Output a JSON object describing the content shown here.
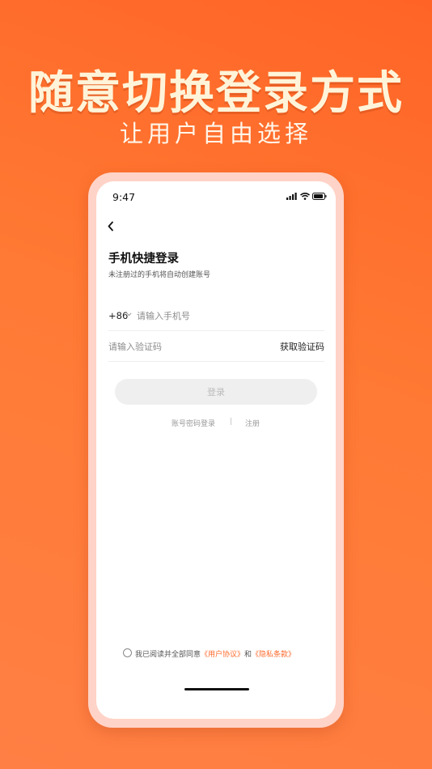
{
  "promo": {
    "headline": "随意切换登录方式",
    "subline": "让用户自由选择"
  },
  "status_bar": {
    "time": "9:47",
    "icons": [
      "signal-icon",
      "wifi-icon",
      "battery-icon"
    ]
  },
  "login": {
    "back_icon": "chevron-left-icon",
    "title": "手机快捷登录",
    "subtitle": "未注册过的手机将自动创建账号",
    "country_code": "+86",
    "phone_placeholder": "请输入手机号",
    "code_placeholder": "请输入验证码",
    "get_code_label": "获取验证码",
    "login_button_label": "登录",
    "password_login_label": "账号密码登录",
    "divider": "|",
    "register_label": "注册"
  },
  "agreement": {
    "prefix": "我已阅读并全部同意",
    "user_agreement": "《用户协议》",
    "conjunction": "和",
    "privacy_policy": "《隐私条款》"
  },
  "colors": {
    "background": "#ff6e2e",
    "accent": "#ff6a2d",
    "disabled_button": "#efefef"
  }
}
